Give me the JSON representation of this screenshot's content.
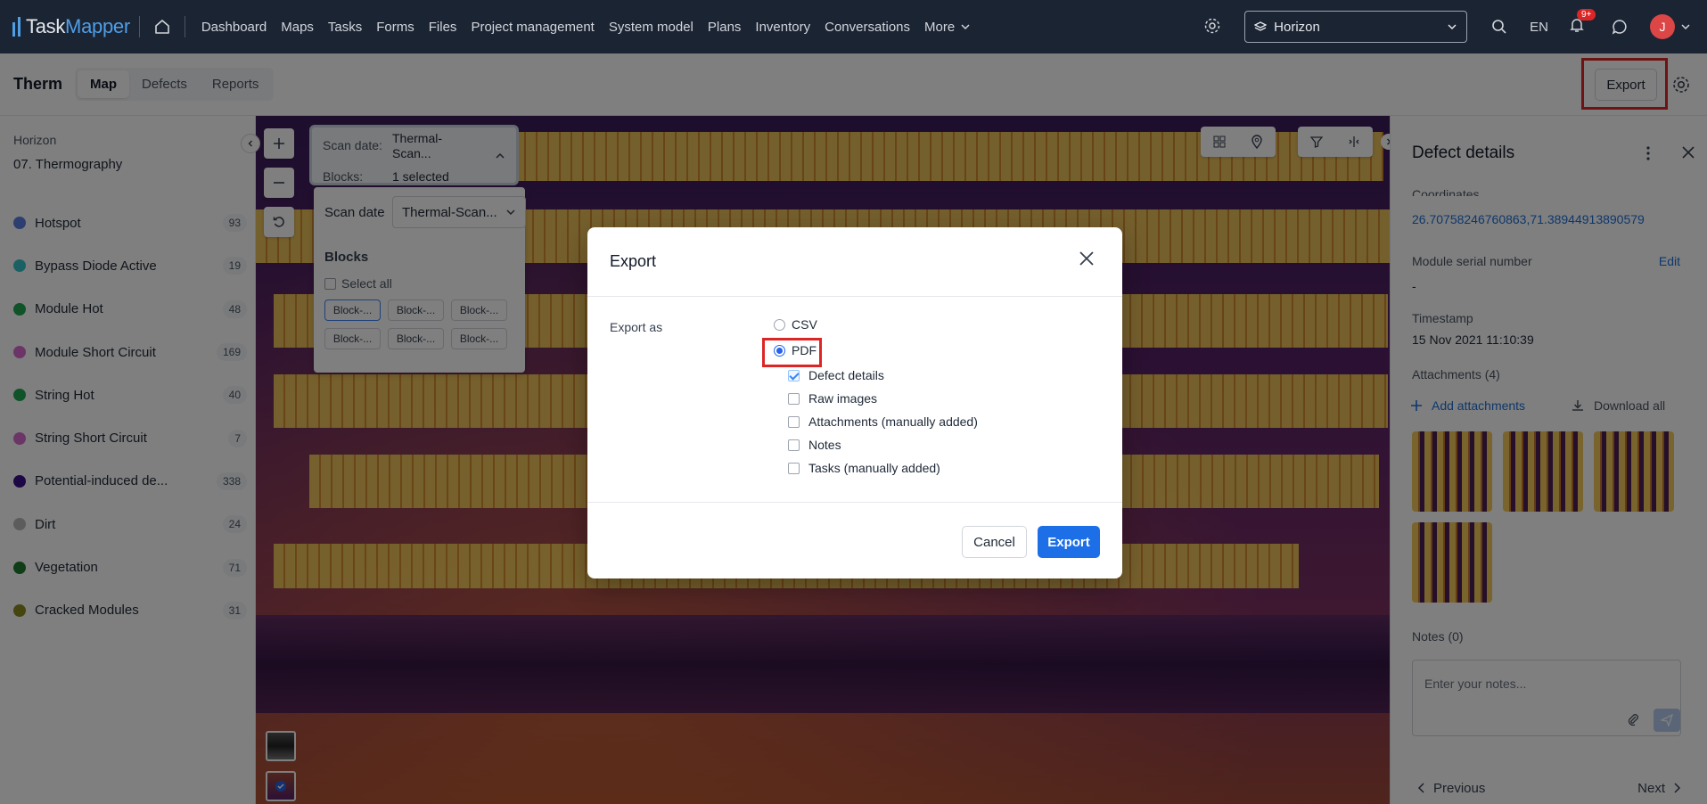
{
  "app": {
    "logo_task": "Task",
    "logo_mapper": "Mapper"
  },
  "nav": {
    "items": [
      "Dashboard",
      "Maps",
      "Tasks",
      "Forms",
      "Files",
      "Project management",
      "System model",
      "Plans",
      "Inventory",
      "Conversations"
    ],
    "more_label": "More"
  },
  "topbar": {
    "workspace": "Horizon",
    "language": "EN",
    "notif_badge": "9+",
    "avatar_initial": "J"
  },
  "subbar": {
    "module_title": "Therm",
    "tabs": [
      {
        "label": "Map",
        "active": true
      },
      {
        "label": "Defects",
        "active": false
      },
      {
        "label": "Reports",
        "active": false
      }
    ],
    "export_label": "Export"
  },
  "sidebar": {
    "crumb_project": "Horizon",
    "crumb_section": "07. Thermography",
    "defects": [
      {
        "name": "Hotspot",
        "count": "93",
        "color": "#5b7fe0"
      },
      {
        "name": "Bypass Diode Active",
        "count": "19",
        "color": "#37c2c9"
      },
      {
        "name": "Module Hot",
        "count": "48",
        "color": "#22a653"
      },
      {
        "name": "Module Short Circuit",
        "count": "169",
        "color": "#d86ad1"
      },
      {
        "name": "String Hot",
        "count": "40",
        "color": "#22a653"
      },
      {
        "name": "String Short Circuit",
        "count": "7",
        "color": "#d86ad1"
      },
      {
        "name": "Potential-induced de...",
        "count": "338",
        "color": "#3a0f8a"
      },
      {
        "name": "Dirt",
        "count": "24",
        "color": "#b8b8b8"
      },
      {
        "name": "Vegetation",
        "count": "71",
        "color": "#1f7a2e"
      },
      {
        "name": "Cracked Modules",
        "count": "31",
        "color": "#8a8a20"
      }
    ]
  },
  "map": {
    "scan_date_label": "Scan date:",
    "scan_date_value": "Thermal-Scan...",
    "blocks_label": "Blocks:",
    "blocks_value": "1 selected",
    "popover_scan_label": "Scan date",
    "popover_scan_value": "Thermal-Scan...",
    "popover_blocks_title": "Blocks",
    "select_all": "Select all",
    "block_chips": [
      "Block-...",
      "Block-...",
      "Block-...",
      "Block-...",
      "Block-...",
      "Block-..."
    ]
  },
  "details": {
    "title": "Defect details",
    "coordinates_label": "Coordinates",
    "coordinates_value": "26.70758246760863,71.38944913890579",
    "serial_label": "Module serial number",
    "serial_value": "-",
    "edit_label": "Edit",
    "timestamp_label": "Timestamp",
    "timestamp_value": "15 Nov 2021 11:10:39",
    "attachments_label": "Attachments (4)",
    "add_attachments": "Add attachments",
    "download_all": "Download all",
    "notes_label": "Notes (0)",
    "notes_placeholder": "Enter your notes...",
    "previous": "Previous",
    "next": "Next"
  },
  "modal": {
    "title": "Export",
    "export_as_label": "Export as",
    "format_options": [
      {
        "label": "CSV",
        "selected": false
      },
      {
        "label": "PDF",
        "selected": true
      }
    ],
    "pdf_options": [
      {
        "label": "Defect details",
        "checked": true
      },
      {
        "label": "Raw images",
        "checked": false
      },
      {
        "label": "Attachments (manually added)",
        "checked": false
      },
      {
        "label": "Notes",
        "checked": false
      },
      {
        "label": "Tasks (manually added)",
        "checked": false
      }
    ],
    "cancel_label": "Cancel",
    "export_label": "Export"
  }
}
